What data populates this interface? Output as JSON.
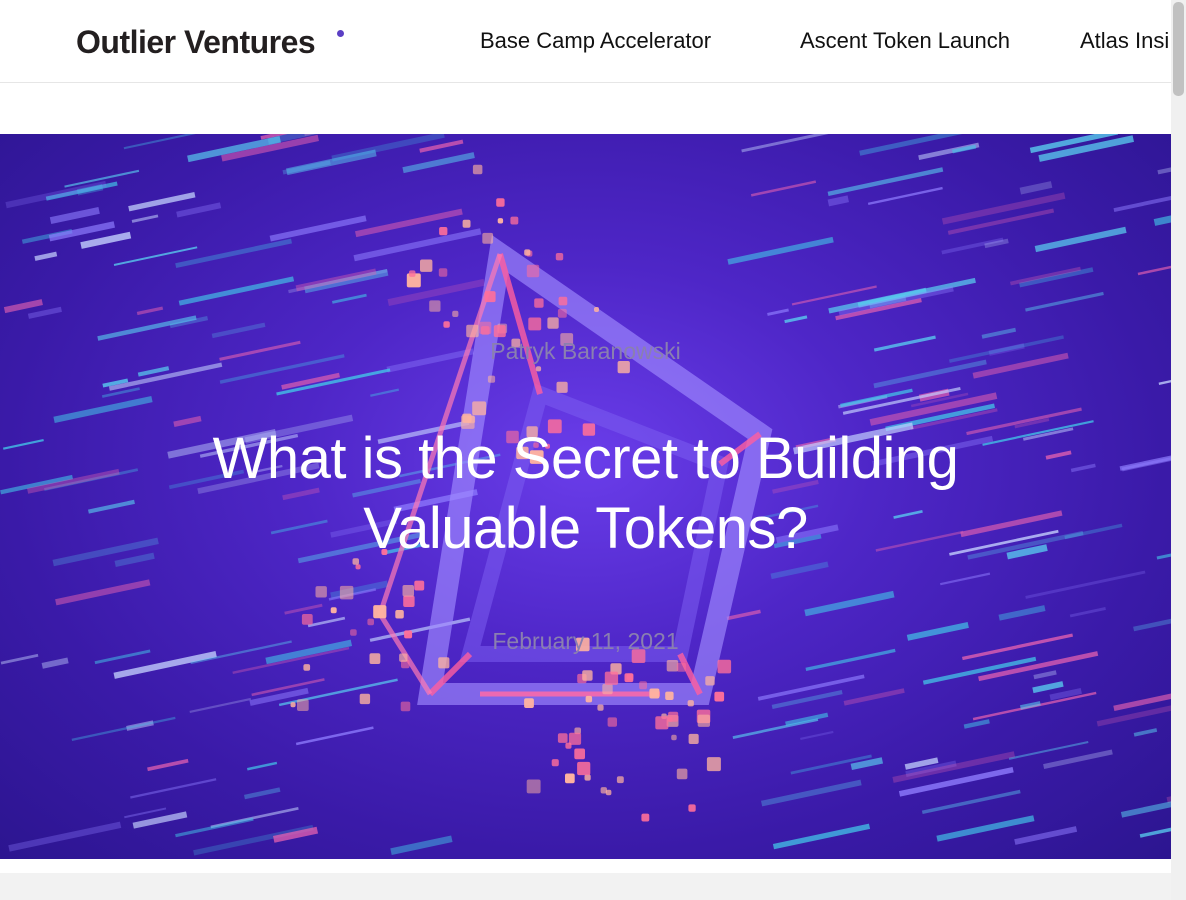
{
  "header": {
    "logo_text": "Outlier Ventures",
    "nav": [
      {
        "label": "Base Camp Accelerator"
      },
      {
        "label": "Ascent Token Launch"
      },
      {
        "label": "Atlas Insi"
      }
    ]
  },
  "hero": {
    "author": "Patryk Baranowski",
    "title": "What is the Secret to Building Valuable Tokens?",
    "date": "February 11, 2021"
  },
  "colors": {
    "accent": "#5b3fc4",
    "hero_bg": "#4e26c7",
    "meta_text": "#8a7fb0"
  },
  "icons": {
    "logo_dot": "purple-dot-icon",
    "hero_art": "wireframe-cube-icon"
  }
}
